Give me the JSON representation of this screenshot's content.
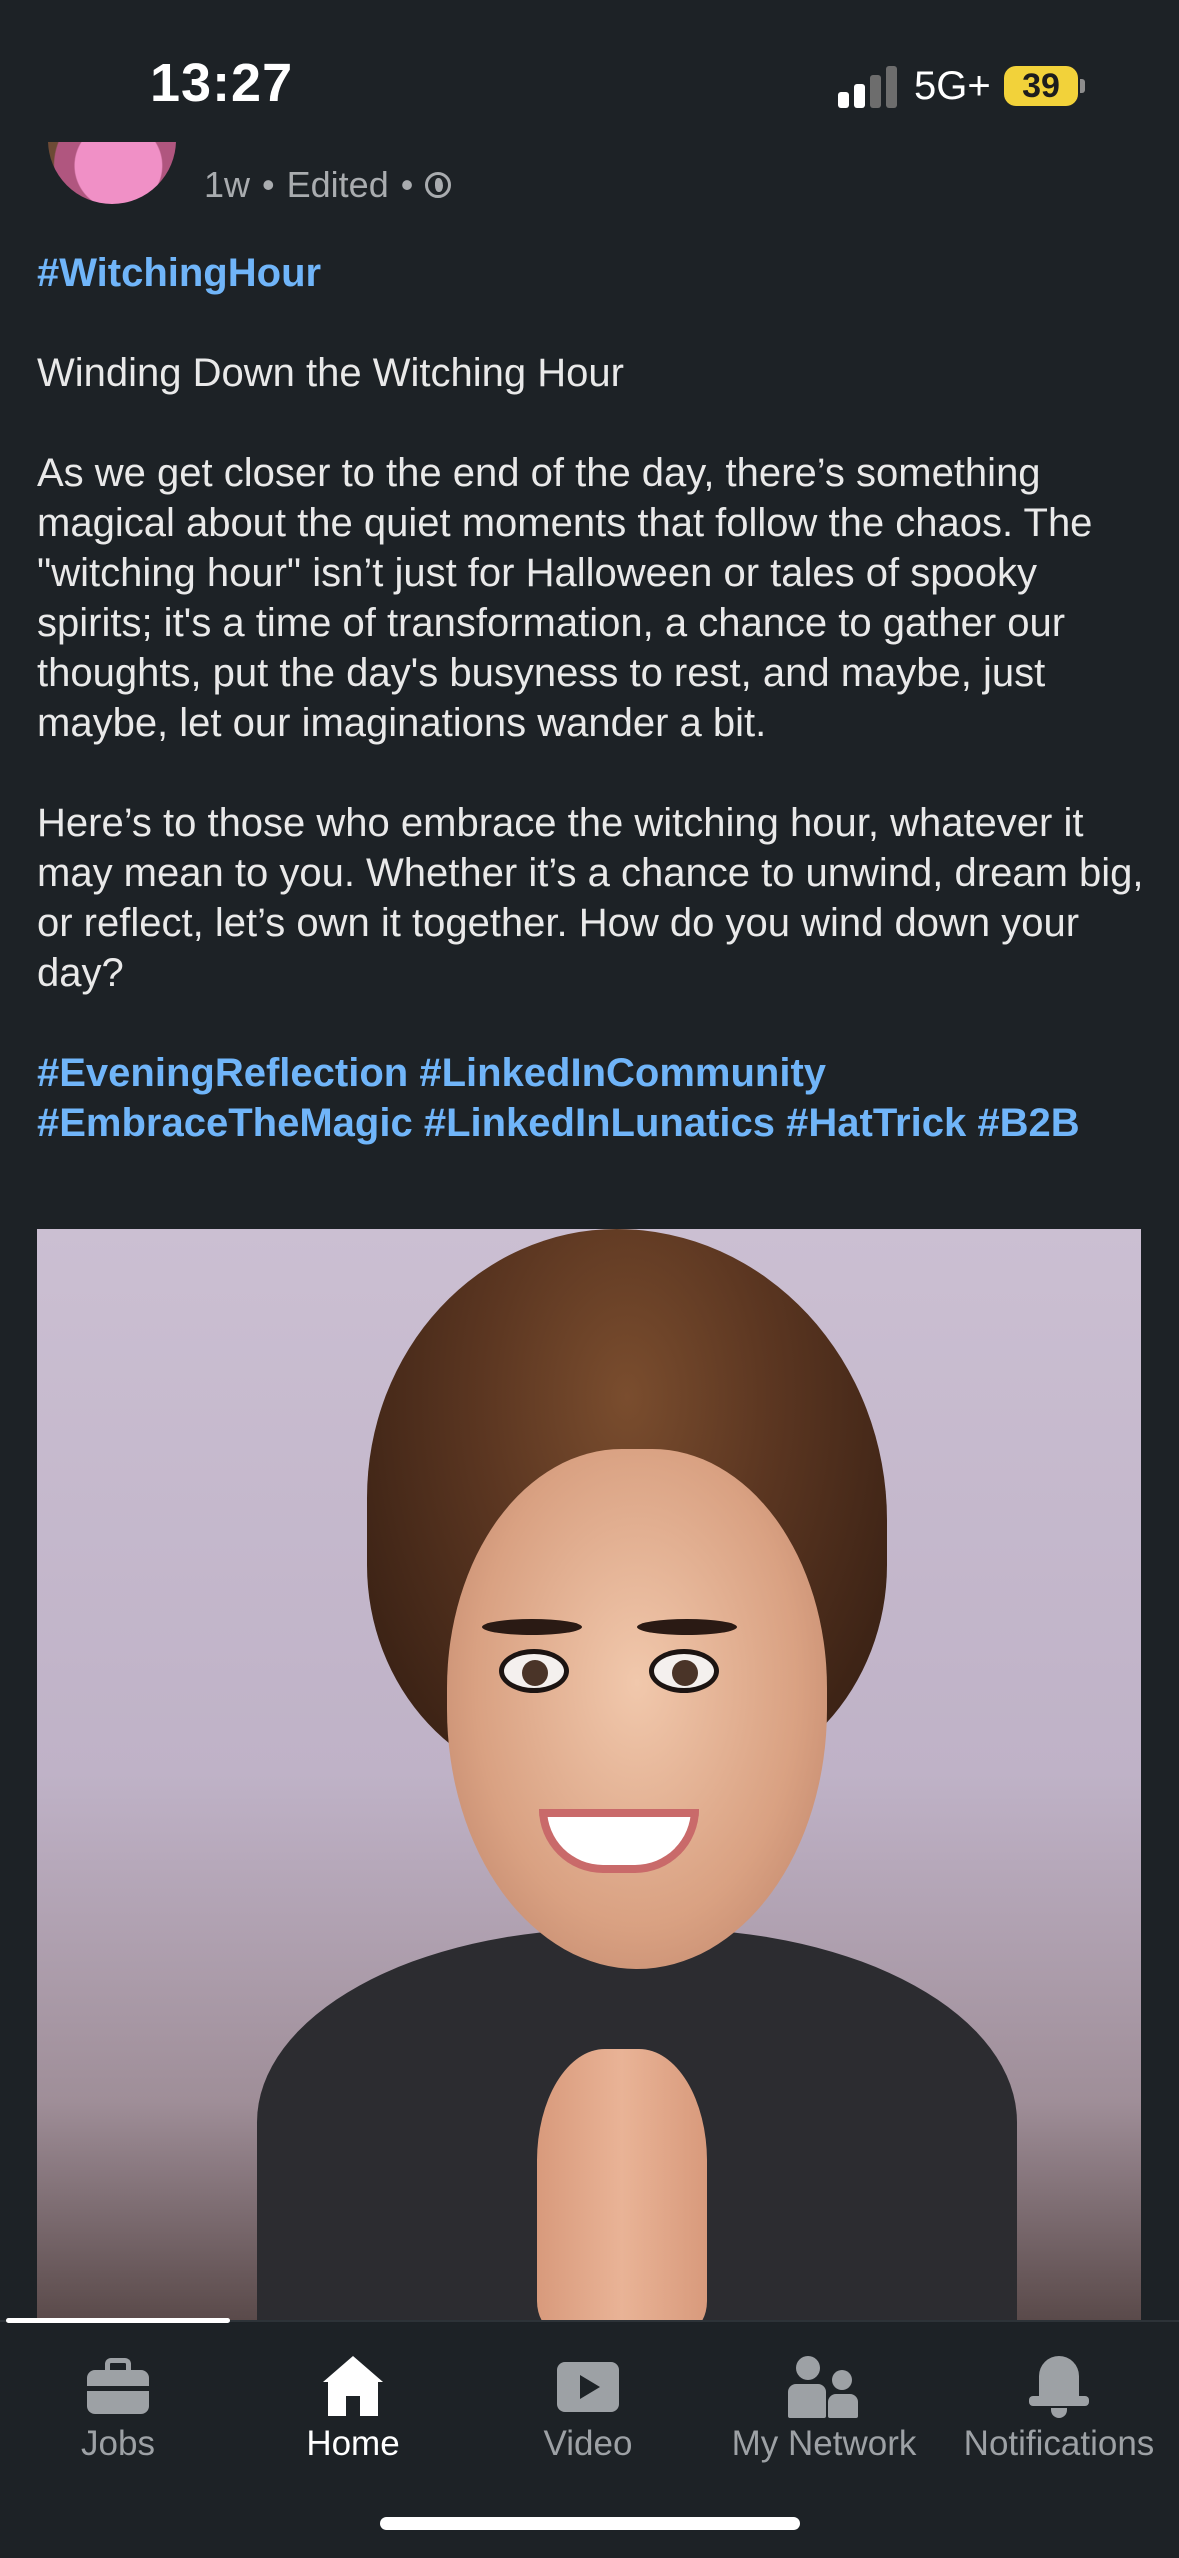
{
  "status_bar": {
    "time": "13:27",
    "network": "5G+",
    "battery": "39"
  },
  "post": {
    "meta": {
      "age": "1w",
      "separator": "•",
      "edited": "Edited",
      "separator2": "•",
      "visibility_icon": "globe-icon"
    },
    "hashtag_top": "#WitchingHour",
    "title": "Winding Down the Witching Hour",
    "paragraph1": "As we get closer to the end of the day, there’s something magical about the quiet moments that follow the chaos. The \"witching hour\" isn’t just for Halloween or tales of spooky spirits; it's a time of transformation, a chance to gather our thoughts, put the day's busyness to rest, and maybe, just maybe, let our imaginations wander a bit.",
    "paragraph2": "Here’s to those who embrace the witching hour, whatever it may mean to you. Whether it’s a chance to unwind, dream big, or reflect, let’s own it together. How do you wind down your day?",
    "hashtags": [
      "#EveningReflection",
      "#LinkedInCommunity",
      "#EmbraceTheMagic",
      "#LinkedInLunatics",
      "#HatTrick",
      "#B2B"
    ]
  },
  "tab_bar": {
    "tabs": [
      {
        "label": "Home",
        "icon": "home-icon",
        "active": true
      },
      {
        "label": "Video",
        "icon": "video-icon",
        "active": false
      },
      {
        "label": "My Network",
        "icon": "network-icon",
        "active": false
      },
      {
        "label": "Notifications",
        "icon": "bell-icon",
        "active": false
      },
      {
        "label": "Jobs",
        "icon": "briefcase-icon",
        "active": false
      }
    ]
  },
  "colors": {
    "background": "#1d2226",
    "hashtag": "#70b5f9",
    "text": "#e9e9e9",
    "muted": "#a9acaf",
    "battery": "#f2d23a"
  }
}
